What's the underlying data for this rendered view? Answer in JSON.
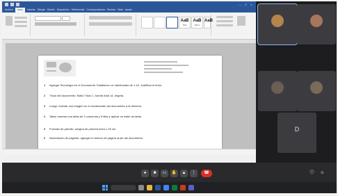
{
  "word": {
    "tabs": [
      "Archivo",
      "Inicio",
      "Insertar",
      "Dibujar",
      "Diseño",
      "Disposición",
      "Referencias",
      "Correspondencia",
      "Revisar",
      "Vista",
      "Ayuda"
    ],
    "styles": [
      {
        "sample": "AaB",
        "name": "Título"
      },
      {
        "sample": "AaB",
        "name": "Título 1"
      },
      {
        "sample": "AaB",
        "name": "Título 2"
      }
    ],
    "list_items": [
      {
        "num": "1",
        "text": "Agregar Tecnología en el Documento. Establecer un interlineado de 1.15. Justificar el texto."
      },
      {
        "num": "2",
        "text": "Título del documento: Estilo Título 1, fuente Arial 14, negrita."
      },
      {
        "num": "3",
        "text": "Luego, insertar una imagen en el encabezado del documento a la derecha."
      },
      {
        "num": "4",
        "text": "Tabla: insertar una tabla de 3 columnas y 5 filas y aplicar un estilo de tabla."
      },
      {
        "num": "5",
        "text": "Formato de párrafo: sangría de primera línea 1.25 cm."
      },
      {
        "num": "6",
        "text": "Numeración de páginas: agregar el número de página al pie del documento."
      }
    ]
  },
  "meeting": {
    "participants": [
      {
        "initial": "",
        "color": "#b5834c",
        "active": true
      },
      {
        "initial": "",
        "color": "#a8755f",
        "active": false
      },
      {
        "initial": "",
        "color": "#6a5e55",
        "active": false
      },
      {
        "initial": "",
        "color": "#7a6a58",
        "active": false
      },
      {
        "initial": "D",
        "color": "#3c3c40",
        "active": false
      }
    ]
  }
}
